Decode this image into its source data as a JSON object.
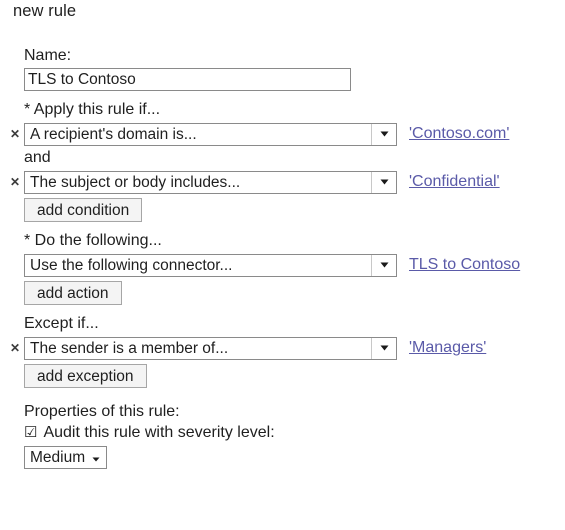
{
  "page": {
    "heading": "new rule"
  },
  "name_field": {
    "label": "Name:",
    "value": "TLS to Contoso",
    "placeholder": ""
  },
  "conditions": {
    "section_label": "* Apply this rule if...",
    "conjunction": "and",
    "add_button": "add condition",
    "rows": [
      {
        "remove_icon": "close-icon",
        "predicate": "A recipient's domain is...",
        "value": "'Contoso.com'"
      },
      {
        "remove_icon": "close-icon",
        "predicate": "The subject or body includes...",
        "value": "'Confidential'"
      }
    ]
  },
  "actions": {
    "section_label": "* Do the following...",
    "add_button": "add action",
    "rows": [
      {
        "predicate": "Use the following connector...",
        "value": "TLS to Contoso"
      }
    ]
  },
  "exceptions": {
    "section_label": "Except if...",
    "add_button": "add exception",
    "rows": [
      {
        "remove_icon": "close-icon",
        "predicate": "The sender is a member of...",
        "value": "'Managers'"
      }
    ]
  },
  "properties": {
    "section_label": "Properties of this rule:",
    "audit_checkbox": {
      "glyph": "☑",
      "label": "Audit this rule with severity level:",
      "checked": true
    },
    "severity": {
      "value": "Medium",
      "arrow_icon": "chevron-down-icon"
    }
  },
  "colors": {
    "link": "#5a5aa8",
    "text": "#1f1f1f",
    "border": "#8a8a8a",
    "button_face": "#f4f4f4"
  }
}
